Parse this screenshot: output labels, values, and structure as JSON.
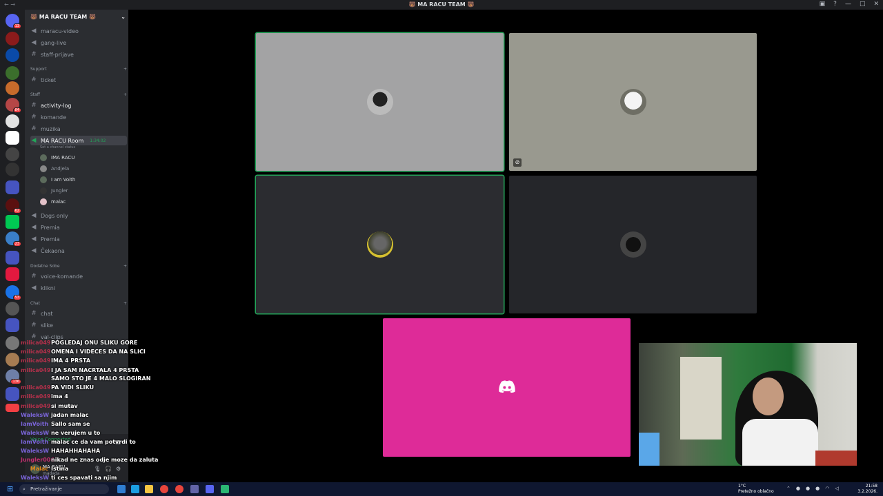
{
  "window": {
    "title": "🐻 MA RACU TEAM 🐻"
  },
  "server": {
    "name": "🐻 MA RACU TEAM 🐻"
  },
  "channels": [
    {
      "name": "maracu-video",
      "type": "voice"
    },
    {
      "name": "gang-live",
      "type": "voice"
    },
    {
      "name": "staff-prijave",
      "type": "text"
    },
    {
      "name": "ticket",
      "type": "text"
    },
    {
      "name": "activity-log",
      "type": "text"
    },
    {
      "name": "komande",
      "type": "text"
    },
    {
      "name": "muzika",
      "type": "text"
    },
    {
      "name": "MA RACU Room",
      "type": "voice",
      "timer": "1:34:02",
      "status_hint": "Set a channel status"
    },
    {
      "name": "Dogs only",
      "type": "voice"
    },
    {
      "name": "Premia",
      "type": "voice"
    },
    {
      "name": "Premia",
      "type": "voice"
    },
    {
      "name": "Čekaona",
      "type": "voice"
    },
    {
      "name": "voice-komande",
      "type": "text"
    },
    {
      "name": "klikni",
      "type": "voice"
    },
    {
      "name": "chat",
      "type": "text"
    },
    {
      "name": "slike",
      "type": "text"
    },
    {
      "name": "val-clips",
      "type": "text"
    }
  ],
  "categories": [
    "Support",
    "Staff",
    "Dodatne Sobe",
    "Chat"
  ],
  "voice_users": [
    "IMA RACU",
    "Andjela",
    "I am Voith",
    "Jungler",
    "malac"
  ],
  "voice_status": {
    "connected": "Voice Connected"
  },
  "user": {
    "name": "MA RACU",
    "status": "madada"
  },
  "chat": [
    {
      "user": "milica049",
      "text": "POGLEDAJ ONU SLIKU GORE",
      "color": "#b0304a"
    },
    {
      "user": "milica049",
      "text": "OMENA I VIDECES DA NA SLICI",
      "color": "#b0304a"
    },
    {
      "user": "milica049",
      "text": "IMA 4 PRSTA",
      "color": "#b0304a"
    },
    {
      "user": "milica049",
      "text": "I JA SAM NACRTALA 4 PRSTA",
      "color": "#b0304a"
    },
    {
      "user": "milica049",
      "text": "SAMO STO JE 4 MALO SLOGIRAN",
      "color": "#b0304a"
    },
    {
      "user": "milica049",
      "text": "PA VIDI SLIKU",
      "color": "#b0304a"
    },
    {
      "user": "milica049",
      "text": "ima 4",
      "color": "#b0304a"
    },
    {
      "user": "milica049",
      "text": "si mutav",
      "color": "#b0304a"
    },
    {
      "user": "WaleksW",
      "text": "jadan malac",
      "color": "#7a64d8"
    },
    {
      "user": "IamVoith",
      "text": "Sallo sam se",
      "color": "#7a64d8"
    },
    {
      "user": "WaleksW",
      "text": "ne verujem u to",
      "color": "#7a64d8"
    },
    {
      "user": "IamVoith",
      "text": "malac ce da vam potvrdi to",
      "color": "#7a64d8"
    },
    {
      "user": "WaleksW",
      "text": "HAHAHHAHAHA",
      "color": "#7a64d8"
    },
    {
      "user": "Jungler006",
      "text": "nikad ne znas odje moze da zaluta",
      "color": "#c02f6e"
    },
    {
      "user": "Malac",
      "text": "Istina",
      "color": "#e08a1e"
    },
    {
      "user": "WaleksW",
      "text": "ti ces spavati sa njim",
      "color": "#7a64d8"
    }
  ],
  "taskbar": {
    "search_placeholder": "Pretraživanje",
    "weather": "1°C",
    "weather_desc": "Pretežno oblačno",
    "time": "21:58",
    "date": "3.2.2026."
  },
  "colors": {
    "accent": "#23a559",
    "pink_tile": "#de2b98",
    "stage_bg": "#000000"
  }
}
